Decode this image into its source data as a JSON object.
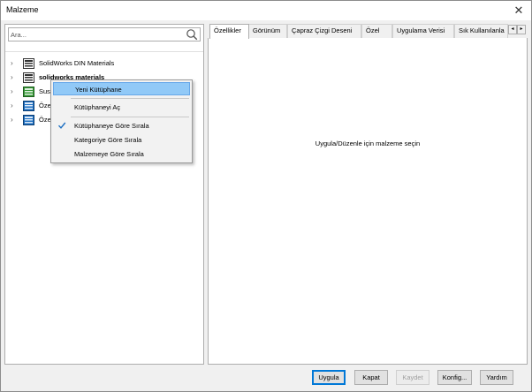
{
  "window": {
    "title": "Malzeme",
    "close_symbol": "✕"
  },
  "search": {
    "placeholder": "Ara..."
  },
  "tree": {
    "items": [
      {
        "label": "SolidWorks DIN Materials",
        "bold": false,
        "icon": "library-icon"
      },
      {
        "label": "solidworks materials",
        "bold": true,
        "icon": "library-icon"
      },
      {
        "label": "Sus",
        "bold": false,
        "icon": "library-green-icon"
      },
      {
        "label": "Öze",
        "bold": false,
        "icon": "library-blue-icon"
      },
      {
        "label": "Öze",
        "bold": false,
        "icon": "library-blue-icon"
      }
    ]
  },
  "context_menu": {
    "items": [
      {
        "label": "Yeni Kütüphane",
        "highlighted": true,
        "checked": false
      },
      {
        "label": "Kütüphaneyi Aç",
        "highlighted": false,
        "checked": false
      },
      {
        "label": "Kütüphaneye Göre Sırala",
        "highlighted": false,
        "checked": true
      },
      {
        "label": "Kategoriye Göre Sırala",
        "highlighted": false,
        "checked": false
      },
      {
        "label": "Malzemeye Göre Sırala",
        "highlighted": false,
        "checked": false
      }
    ]
  },
  "tabs": [
    {
      "label": "Özellikler",
      "active": true
    },
    {
      "label": "Görünüm",
      "active": false
    },
    {
      "label": "Çapraz Çizgi Deseni",
      "active": false
    },
    {
      "label": "Özel",
      "active": false
    },
    {
      "label": "Uygulama Verisi",
      "active": false
    },
    {
      "label": "Sık Kullanılanla",
      "active": false
    }
  ],
  "tab_scroll": {
    "left": "◂",
    "right": "▸"
  },
  "main": {
    "prompt": "Uygula/Düzenle için malzeme seçin"
  },
  "buttons": {
    "apply": "Uygula",
    "close": "Kapat",
    "save": "Kaydet",
    "config": "Konfig...",
    "help": "Yardım"
  },
  "colors": {
    "highlight": "#91c9f7",
    "default_button_border": "#0078d7",
    "library_green": "#3a9a3a",
    "library_blue": "#1c6fc2"
  }
}
